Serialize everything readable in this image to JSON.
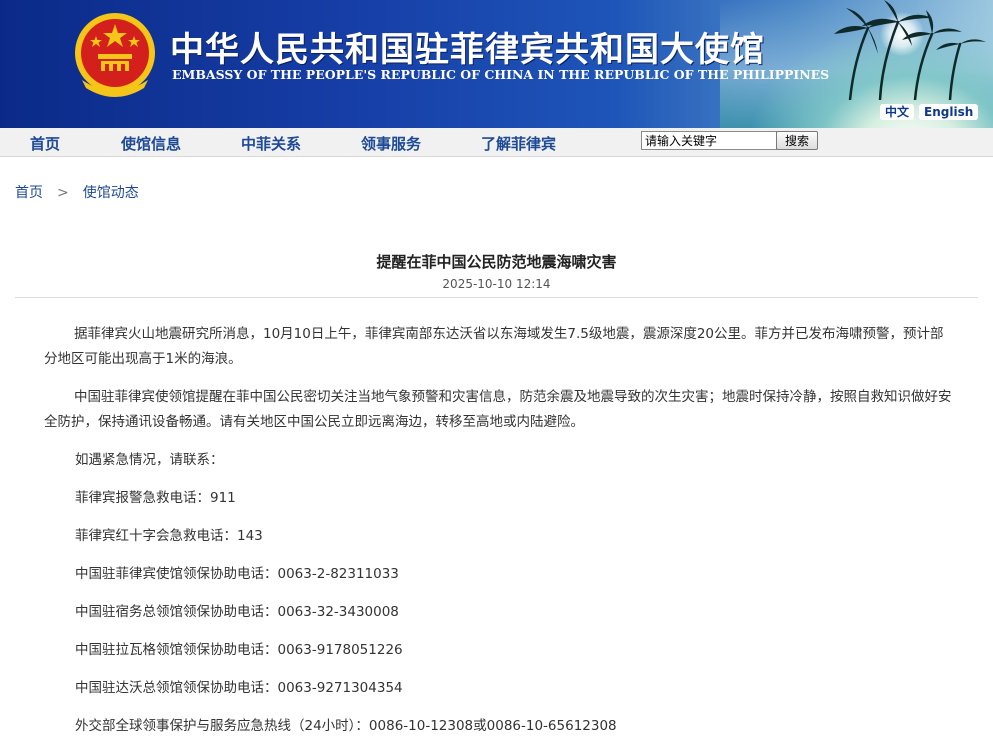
{
  "header": {
    "title_cn": "中华人民共和国驻菲律宾共和国大使馆",
    "title_en": "EMBASSY OF THE PEOPLE'S REPUBLIC OF CHINA IN THE REPUBLIC OF THE PHILIPPINES",
    "lang": {
      "zh": "中文",
      "en": "English"
    }
  },
  "nav": {
    "items": [
      {
        "label": "首页"
      },
      {
        "label": "使馆信息"
      },
      {
        "label": "中菲关系"
      },
      {
        "label": "领事服务"
      },
      {
        "label": "了解菲律宾"
      }
    ],
    "search": {
      "value": "请输入关键字",
      "button": "搜索"
    }
  },
  "breadcrumb": {
    "items": [
      "首页",
      "使馆动态"
    ],
    "separator": ">"
  },
  "article": {
    "title": "提醒在菲中国公民防范地震海啸灾害",
    "date": "2025-10-10 12:14",
    "paragraphs": [
      "据菲律宾火山地震研究所消息，10月10日上午，菲律宾南部东达沃省以东海域发生7.5级地震，震源深度20公里。菲方并已发布海啸预警，预计部分地区可能出现高于1米的海浪。",
      "中国驻菲律宾使领馆提醒在菲中国公民密切关注当地气象预警和灾害信息，防范余震及地震导致的次生灾害；地震时保持冷静，按照自救知识做好安全防护，保持通讯设备畅通。请有关地区中国公民立即远离海边，转移至高地或内陆避险。"
    ],
    "contacts": [
      "如遇紧急情况，请联系：",
      "菲律宾报警急救电话：911",
      "菲律宾红十字会急救电话：143",
      "中国驻菲律宾使馆领保协助电话：0063-2-82311033",
      "中国驻宿务总领馆领保协助电话：0063-32-3430008",
      "中国驻拉瓦格领馆领保协助电话：0063-9178051226",
      "中国驻达沃总领馆领保协助电话：0063-9271304354",
      "外交部全球领事保护与服务应急热线（24小时）：0086-10-12308或0086-10-65612308"
    ]
  },
  "colors": {
    "header_blue": "#163ea6",
    "nav_text": "#1d4996",
    "emblem_red": "#d4201c",
    "emblem_gold": "#f5c518"
  },
  "icons": [
    "national-emblem-icon",
    "palm-trees-icon"
  ]
}
